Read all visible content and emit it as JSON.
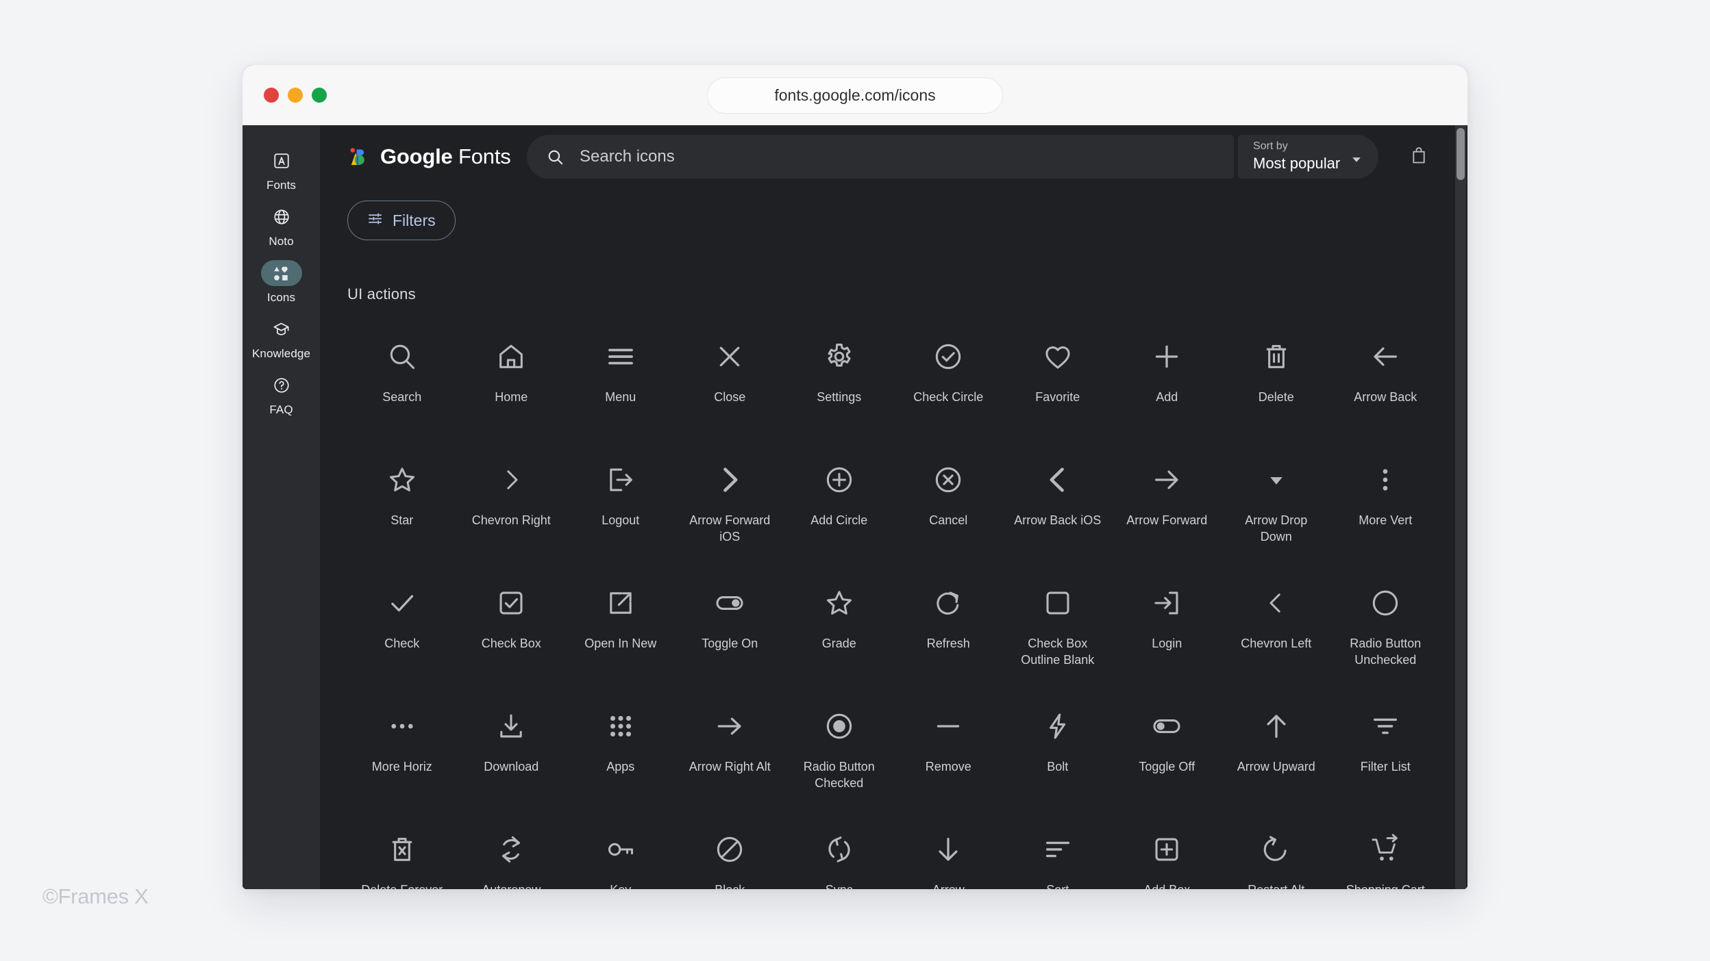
{
  "watermark": "©Frames X",
  "browser": {
    "url": "fonts.google.com/icons",
    "traffic_lights": [
      "close-red",
      "minimize-yellow",
      "maximize-green"
    ]
  },
  "sidebar": {
    "items": [
      {
        "label": "Fonts",
        "icon": "letter-a-box-icon",
        "active": false
      },
      {
        "label": "Noto",
        "icon": "globe-icon",
        "active": false
      },
      {
        "label": "Icons",
        "icon": "shapes-icon",
        "active": true
      },
      {
        "label": "Knowledge",
        "icon": "graduation-cap-icon",
        "active": false
      },
      {
        "label": "FAQ",
        "icon": "question-circle-icon",
        "active": false
      }
    ]
  },
  "header": {
    "brand_bold": "Google",
    "brand_light": "Fonts",
    "search": {
      "placeholder": "Search icons",
      "value": "",
      "icon": "search-icon"
    },
    "sort": {
      "label": "Sort by",
      "value": "Most popular",
      "caret_icon": "chevron-down-icon"
    },
    "bag_icon": "shopping-bag-icon"
  },
  "toolbar": {
    "filters_label": "Filters",
    "filters_icon": "tune-icon"
  },
  "main": {
    "section_title": "UI actions"
  },
  "colors": {
    "page_bg": "#f3f4f6",
    "app_bg": "#1f2023",
    "sidebar_bg": "#2b2c2f",
    "field_bg": "#2b2d31",
    "active_pill": "#4e6c72",
    "filters_text": "#b7c6e8",
    "icon_grey": "#b6b8bb",
    "label_grey": "#cfd1d4",
    "google_red": "#ea4335",
    "google_yellow": "#fbbc04",
    "google_blue": "#4285f4",
    "google_green": "#34a853"
  },
  "icons": [
    {
      "label": "Search",
      "name": "search-icon"
    },
    {
      "label": "Home",
      "name": "home-icon"
    },
    {
      "label": "Menu",
      "name": "menu-icon"
    },
    {
      "label": "Close",
      "name": "close-icon"
    },
    {
      "label": "Settings",
      "name": "settings-icon"
    },
    {
      "label": "Check Circle",
      "name": "check-circle-icon"
    },
    {
      "label": "Favorite",
      "name": "favorite-heart-icon"
    },
    {
      "label": "Add",
      "name": "add-plus-icon"
    },
    {
      "label": "Delete",
      "name": "delete-trash-icon"
    },
    {
      "label": "Arrow Back",
      "name": "arrow-back-icon"
    },
    {
      "label": "Star",
      "name": "star-icon"
    },
    {
      "label": "Chevron Right",
      "name": "chevron-right-icon"
    },
    {
      "label": "Logout",
      "name": "logout-icon"
    },
    {
      "label": "Arrow Forward iOS",
      "name": "arrow-forward-ios-icon"
    },
    {
      "label": "Add Circle",
      "name": "add-circle-icon"
    },
    {
      "label": "Cancel",
      "name": "cancel-icon"
    },
    {
      "label": "Arrow Back iOS",
      "name": "arrow-back-ios-icon"
    },
    {
      "label": "Arrow Forward",
      "name": "arrow-forward-icon"
    },
    {
      "label": "Arrow Drop Down",
      "name": "arrow-drop-down-icon"
    },
    {
      "label": "More Vert",
      "name": "more-vert-icon"
    },
    {
      "label": "Check",
      "name": "check-icon"
    },
    {
      "label": "Check Box",
      "name": "check-box-icon"
    },
    {
      "label": "Open In New",
      "name": "open-in-new-icon"
    },
    {
      "label": "Toggle On",
      "name": "toggle-on-icon"
    },
    {
      "label": "Grade",
      "name": "grade-star-icon"
    },
    {
      "label": "Refresh",
      "name": "refresh-icon"
    },
    {
      "label": "Check Box Outline Blank",
      "name": "check-box-outline-blank-icon"
    },
    {
      "label": "Login",
      "name": "login-icon"
    },
    {
      "label": "Chevron Left",
      "name": "chevron-left-icon"
    },
    {
      "label": "Radio Button Unchecked",
      "name": "radio-button-unchecked-icon"
    },
    {
      "label": "More Horiz",
      "name": "more-horiz-icon"
    },
    {
      "label": "Download",
      "name": "download-icon"
    },
    {
      "label": "Apps",
      "name": "apps-grid-icon"
    },
    {
      "label": "Arrow Right Alt",
      "name": "arrow-right-alt-icon"
    },
    {
      "label": "Radio Button Checked",
      "name": "radio-button-checked-icon"
    },
    {
      "label": "Remove",
      "name": "remove-minus-icon"
    },
    {
      "label": "Bolt",
      "name": "bolt-icon"
    },
    {
      "label": "Toggle Off",
      "name": "toggle-off-icon"
    },
    {
      "label": "Arrow Upward",
      "name": "arrow-upward-icon"
    },
    {
      "label": "Filter List",
      "name": "filter-list-icon"
    },
    {
      "label": "Delete Forever",
      "name": "delete-forever-icon"
    },
    {
      "label": "Autorenew",
      "name": "autorenew-icon"
    },
    {
      "label": "Key",
      "name": "key-icon"
    },
    {
      "label": "Block",
      "name": "block-icon"
    },
    {
      "label": "Sync",
      "name": "sync-icon"
    },
    {
      "label": "Arrow Downward",
      "name": "arrow-downward-icon"
    },
    {
      "label": "Sort",
      "name": "sort-icon"
    },
    {
      "label": "Add Box",
      "name": "add-box-icon"
    },
    {
      "label": "Restart Alt",
      "name": "restart-alt-icon"
    },
    {
      "label": "Shopping Cart Checkout",
      "name": "shopping-cart-checkout-icon"
    }
  ]
}
